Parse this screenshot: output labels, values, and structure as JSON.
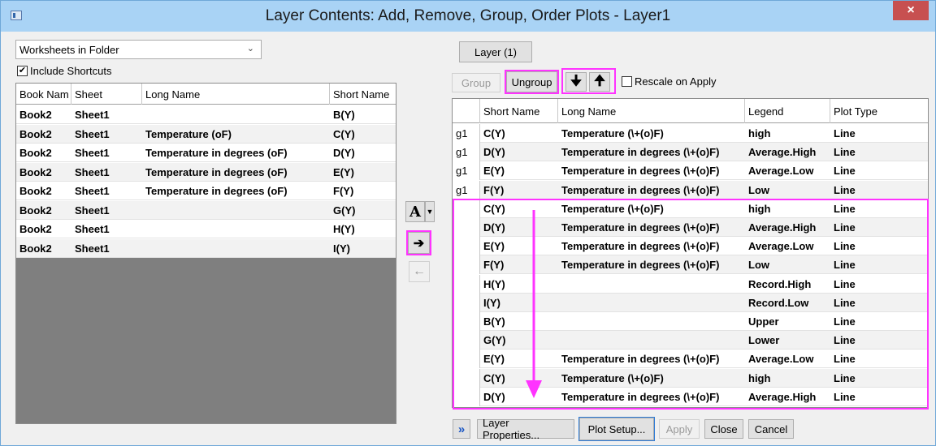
{
  "window": {
    "title": "Layer Contents: Add, Remove, Group, Order Plots - Layer1",
    "close_label": "×"
  },
  "left": {
    "dropdown_value": "Worksheets in Folder",
    "include_shortcuts_label": "Include Shortcuts",
    "include_shortcuts_checked": true,
    "columns": [
      "Book Nam",
      "Sheet",
      "Long Name",
      "Short Name"
    ],
    "rows": [
      [
        "Book2",
        "Sheet1",
        "",
        "B(Y)"
      ],
      [
        "Book2",
        "Sheet1",
        "Temperature (oF)",
        "C(Y)"
      ],
      [
        "Book2",
        "Sheet1",
        "Temperature in degrees (oF)",
        "D(Y)"
      ],
      [
        "Book2",
        "Sheet1",
        "Temperature in degrees (oF)",
        "E(Y)"
      ],
      [
        "Book2",
        "Sheet1",
        "Temperature in degrees (oF)",
        "F(Y)"
      ],
      [
        "Book2",
        "Sheet1",
        "",
        "G(Y)"
      ],
      [
        "Book2",
        "Sheet1",
        "",
        "H(Y)"
      ],
      [
        "Book2",
        "Sheet1",
        "",
        "I(Y)"
      ]
    ]
  },
  "middle": {
    "text_tool_label": "A",
    "add_arrow": "➔",
    "remove_arrow": "←"
  },
  "right": {
    "layer_button": "Layer (1)",
    "group_button": "Group",
    "ungroup_button": "Ungroup",
    "move_down_label": "🠋",
    "move_up_label": "🠉",
    "rescale_label": "Rescale on Apply",
    "columns": [
      "",
      "Short Name",
      "Long Name",
      "Legend",
      "Plot Type"
    ],
    "rows": [
      [
        "g1",
        "C(Y)",
        "Temperature (\\+(o)F)",
        "high",
        "Line"
      ],
      [
        "g1",
        "D(Y)",
        "Temperature in degrees (\\+(o)F)",
        "Average.High",
        "Line"
      ],
      [
        "g1",
        "E(Y)",
        "Temperature in degrees (\\+(o)F)",
        "Average.Low",
        "Line"
      ],
      [
        "g1",
        "F(Y)",
        "Temperature in degrees (\\+(o)F)",
        "Low",
        "Line"
      ],
      [
        "",
        "C(Y)",
        "Temperature (\\+(o)F)",
        "high",
        "Line"
      ],
      [
        "",
        "D(Y)",
        "Temperature in degrees (\\+(o)F)",
        "Average.High",
        "Line"
      ],
      [
        "",
        "E(Y)",
        "Temperature in degrees (\\+(o)F)",
        "Average.Low",
        "Line"
      ],
      [
        "",
        "F(Y)",
        "Temperature in degrees (\\+(o)F)",
        "Low",
        "Line"
      ],
      [
        "",
        "H(Y)",
        "",
        "Record.High",
        "Line"
      ],
      [
        "",
        "I(Y)",
        "",
        "Record.Low",
        "Line"
      ],
      [
        "",
        "B(Y)",
        "",
        "Upper",
        "Line"
      ],
      [
        "",
        "G(Y)",
        "",
        "Lower",
        "Line"
      ],
      [
        "",
        "E(Y)",
        "Temperature in degrees (\\+(o)F)",
        "Average.Low",
        "Line"
      ],
      [
        "",
        "C(Y)",
        "Temperature (\\+(o)F)",
        "high",
        "Line"
      ],
      [
        "",
        "D(Y)",
        "Temperature in degrees (\\+(o)F)",
        "Average.High",
        "Line"
      ]
    ]
  },
  "bottom": {
    "expand_label": "»",
    "layer_properties": "Layer Properties...",
    "plot_setup": "Plot Setup...",
    "apply": "Apply",
    "close": "Close",
    "cancel": "Cancel"
  },
  "colors": {
    "highlight": "#ff33ff",
    "titlebar": "#a9d3f5",
    "close": "#c75050",
    "gray_area": "#7f7f7f"
  }
}
